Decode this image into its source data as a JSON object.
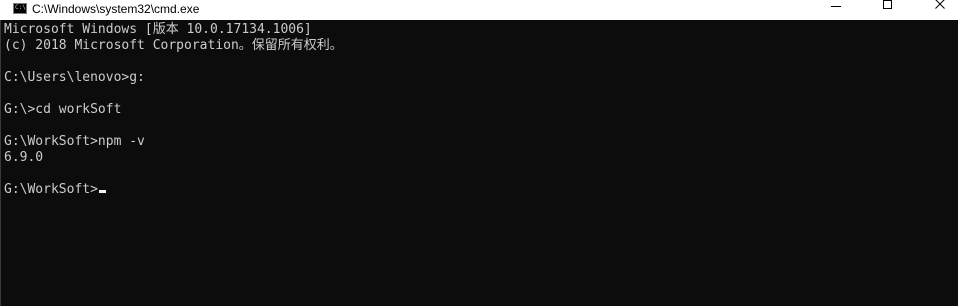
{
  "window": {
    "title": "C:\\Windows\\system32\\cmd.exe",
    "icon": "cmd-app-icon",
    "icon_label": "C:\\",
    "controls": {
      "minimize_icon": "minimize-icon",
      "maximize_icon": "maximize-icon",
      "close_icon": "close-icon"
    }
  },
  "console": {
    "background": "#0c0c0c",
    "foreground": "#cccccc",
    "lines": [
      "Microsoft Windows [版本 10.0.17134.1006]",
      "(c) 2018 Microsoft Corporation。保留所有权利。",
      "",
      "C:\\Users\\lenovo>g:",
      "",
      "G:\\>cd workSoft",
      "",
      "G:\\WorkSoft>npm -v",
      "6.9.0",
      "",
      "G:\\WorkSoft>"
    ]
  }
}
